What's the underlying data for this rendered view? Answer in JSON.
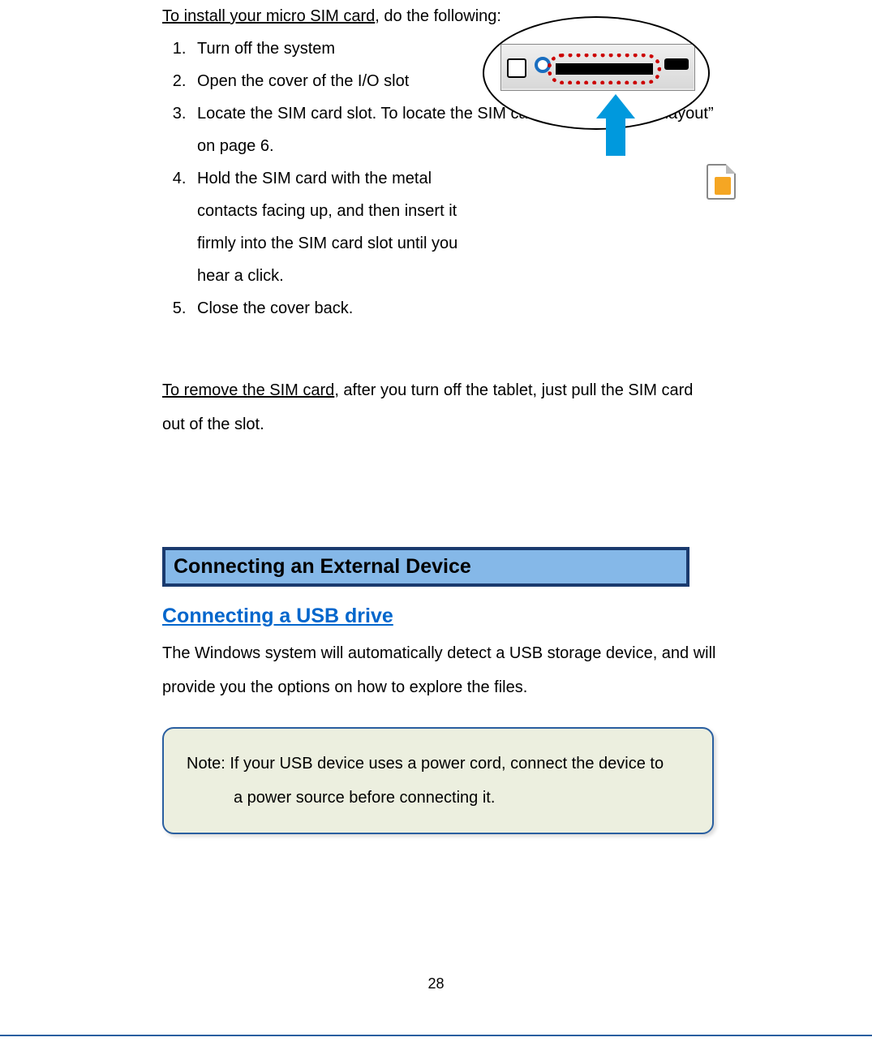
{
  "intro": {
    "prefix_underlined": "To install your micro SIM card",
    "suffix": ", do the following:"
  },
  "install_steps": {
    "item1": "Turn off the system",
    "item2": "Open the cover of the I/O slot",
    "item3": "Locate the SIM card slot. To locate the SIM card slot, see “Tablet layout” on page 6.",
    "item4": "Hold the SIM card with the metal contacts facing up, and then insert it firmly into the SIM card slot until you hear a click.",
    "item5": "Close the cover back."
  },
  "remove": {
    "prefix_underlined": "To remove the SIM card",
    "suffix": ", after you turn off the tablet, just pull the SIM card out of the slot."
  },
  "section_header": "Connecting an External Device",
  "subsection_title": "Connecting a USB drive",
  "usb_body": "The Windows system will automatically detect a USB storage device, and will provide you the options on how to explore the files.",
  "note": {
    "line1": "Note: If your USB device uses a power cord, connect the device to",
    "line2": "a power source before connecting it."
  },
  "page_number": "28",
  "diagram": {
    "description": "SIM card slot location diagram with red dotted highlight and blue up arrow",
    "icon_sim": "sim-card-icon",
    "icon_arrow": "arrow-up-icon"
  }
}
